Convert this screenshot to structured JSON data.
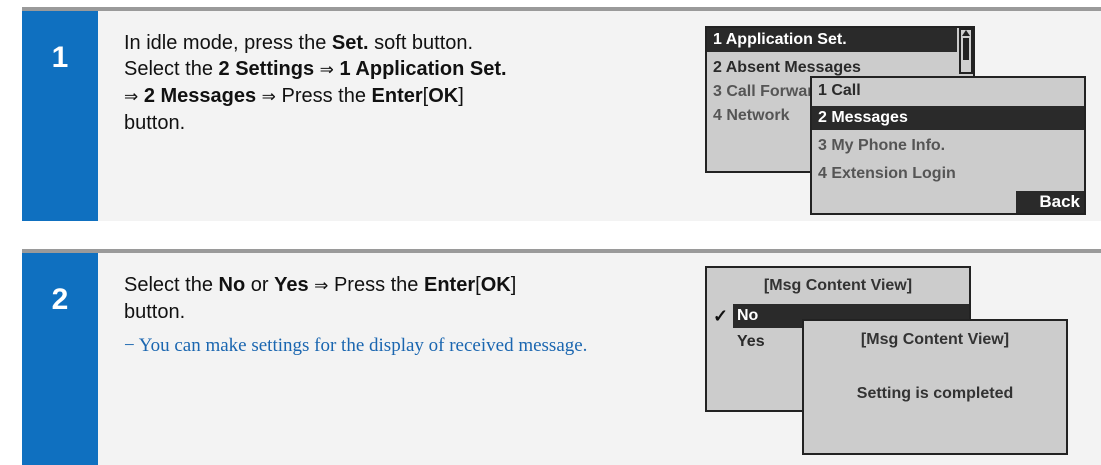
{
  "step1": {
    "number": "1",
    "line1": {
      "pre": "In idle mode, press the ",
      "bold": "Set.",
      "post": " soft button."
    },
    "line2": {
      "pre": "Select the ",
      "bold1": "2 Settings",
      "arrow": "⇒",
      "bold2": "1 Application Set."
    },
    "line3": {
      "arrow1": "⇒",
      "bold1": "2 Messages",
      "arrow2": "⇒",
      "mid": " Press the ",
      "bold2": "Enter",
      "br_open": "[",
      "bold3": "OK",
      "br_close": "]"
    },
    "line4": "button.",
    "screen_back": {
      "items": [
        "1 Application Set.",
        "2 Absent Messages",
        "3 Call Forwarding",
        "4 Network"
      ]
    },
    "screen_front": {
      "items": [
        "1 Call",
        "2 Messages",
        "3 My Phone Info.",
        "4 Extension Login"
      ],
      "softkey": "Back"
    }
  },
  "step2": {
    "number": "2",
    "line1": {
      "pre": "Select the ",
      "bold1": "No",
      "mid1": " or ",
      "bold2": "Yes",
      "arrow": "⇒",
      "mid2": " Press the ",
      "bold3": "Enter",
      "br_open": "[",
      "bold4": "OK",
      "br_close": "]"
    },
    "line2": "button.",
    "note": "− You can make settings for the display of received message.",
    "screen_back": {
      "title": "[Msg Content View]",
      "check": "✓",
      "items": [
        "No",
        "Yes"
      ]
    },
    "screen_front": {
      "title": "[Msg Content View]",
      "message": "Setting is completed"
    }
  }
}
